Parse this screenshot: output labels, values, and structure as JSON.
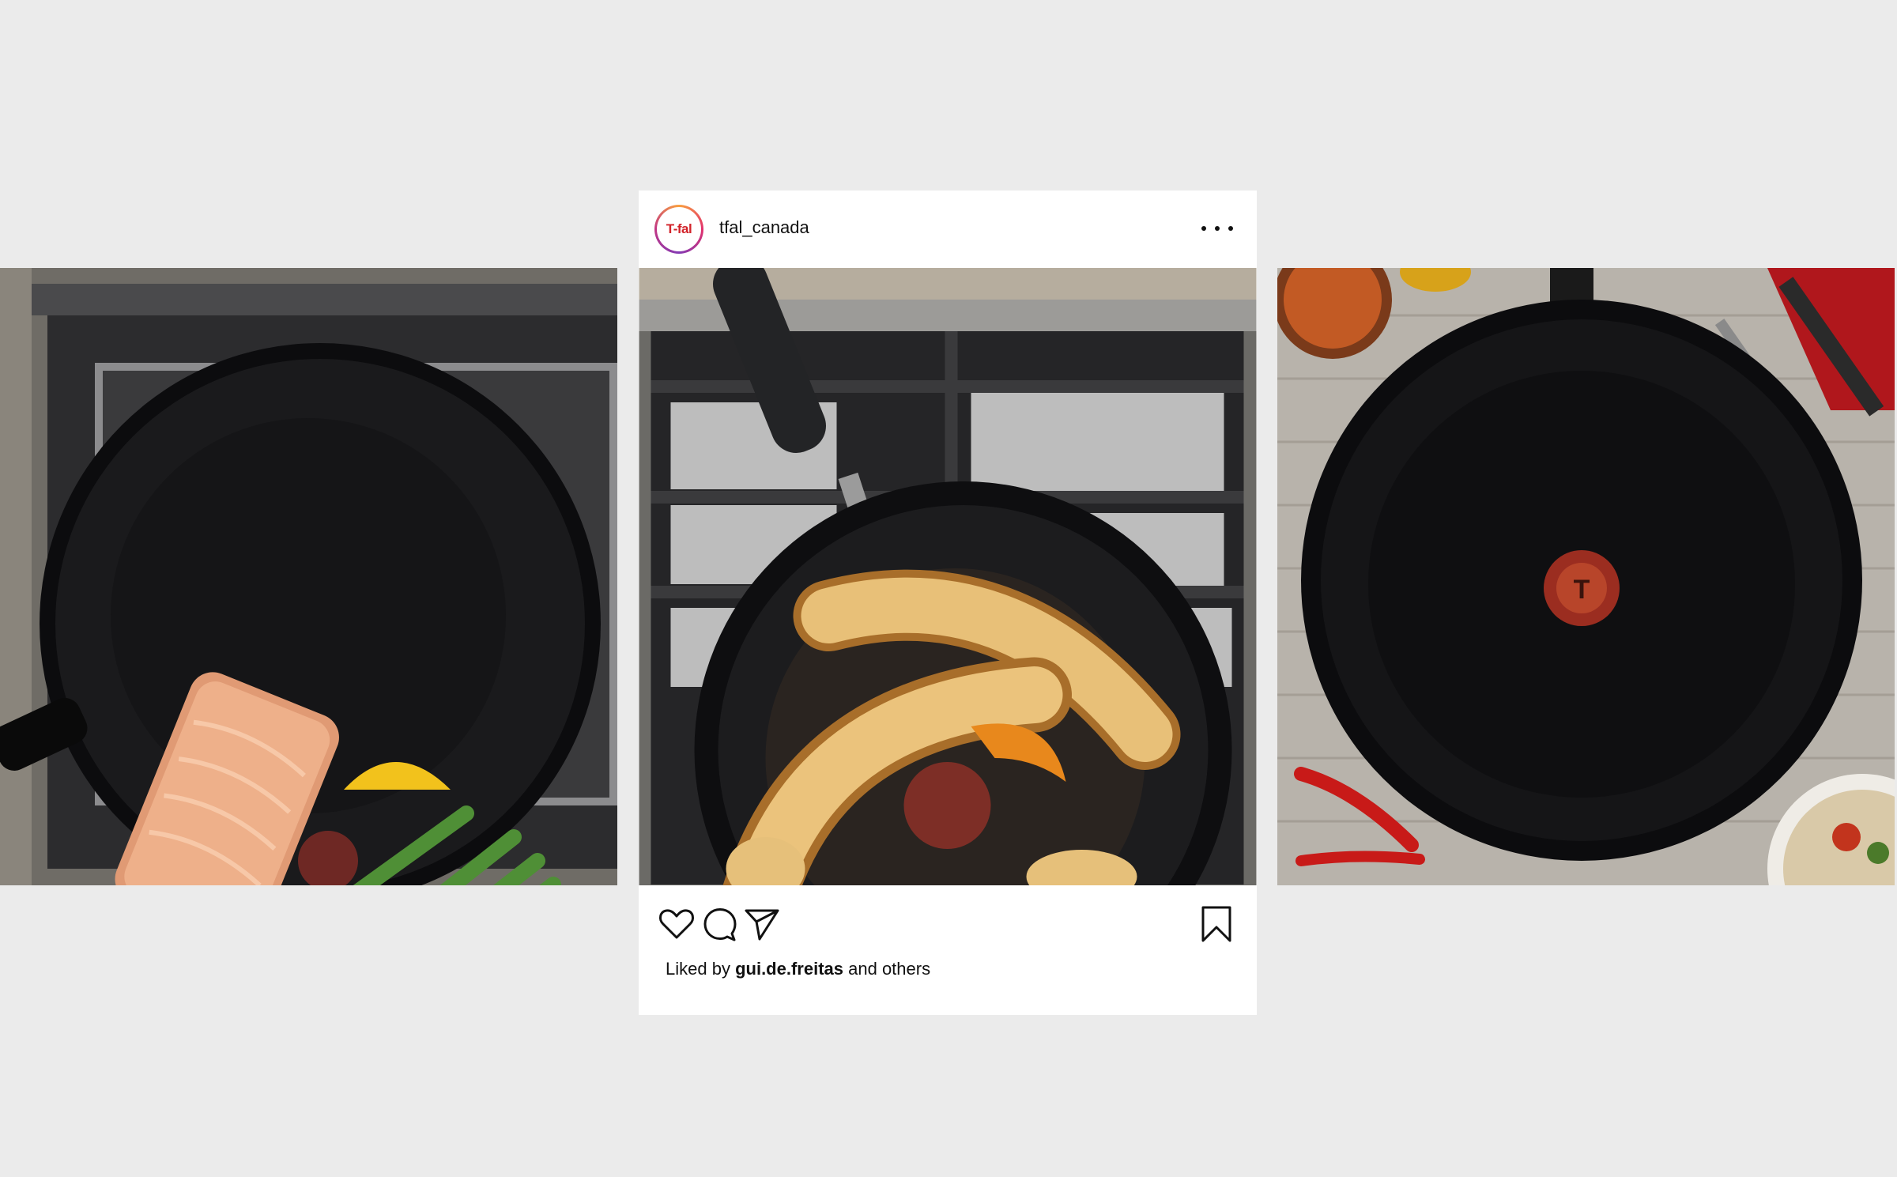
{
  "post": {
    "username": "tfal_canada",
    "avatar_logo_text": "T-fal",
    "likes": {
      "prefix": "Liked by",
      "user": "gui.de.freitas",
      "suffix": "and others"
    },
    "icons": {
      "more": "more-options-icon",
      "like": "heart-icon",
      "comment": "comment-icon",
      "share": "paper-plane-icon",
      "save": "bookmark-icon"
    }
  },
  "colors": {
    "background": "#ebebeb",
    "brand_red": "#d2232a",
    "pan": "#141416"
  }
}
